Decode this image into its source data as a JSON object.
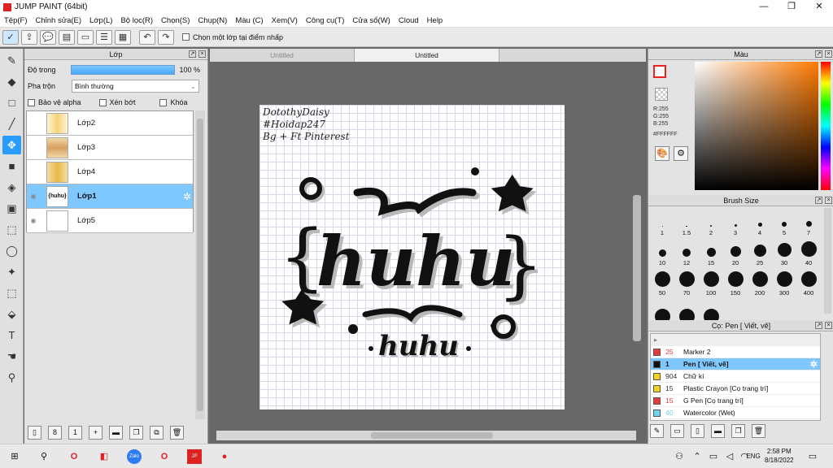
{
  "app": {
    "title": "JUMP PAINT (64bit)"
  },
  "menu": [
    "Tệp(F)",
    "Chỉnh sửa(E)",
    "Lớp(L)",
    "Bộ lọc(R)",
    "Chọn(S)",
    "Chụp(N)",
    "Màu (C)",
    "Xem(V)",
    "Công cụ(T)",
    "Cửa sổ(W)",
    "Cloud",
    "Help"
  ],
  "toolbar": {
    "ref_layer_label": "Chọn một lớp tại điểm nhấp"
  },
  "layer_panel": {
    "title": "Lớp",
    "opacity_label": "Độ trong",
    "opacity_value": "100 %",
    "blend_label": "Pha trộn",
    "blend_value": "Bình thường",
    "protect_alpha": "Bảo vệ alpha",
    "clipping": "Xén bớt",
    "lock": "Khóa",
    "layers": [
      {
        "name": "Lớp2",
        "active": false
      },
      {
        "name": "Lớp3",
        "active": false
      },
      {
        "name": "Lớp4",
        "active": false
      },
      {
        "name": "Lớp1",
        "active": true
      },
      {
        "name": "Lớp5",
        "active": false
      }
    ]
  },
  "canvas": {
    "tabs": [
      "Untitled",
      "Untitled"
    ],
    "text_lines": [
      "DotothyDaisy",
      "#Hoidap247",
      "Bg + Ft Pinterest"
    ],
    "main_word": "huhu",
    "sub_word": "huhu"
  },
  "color_panel": {
    "title": "Màu",
    "r": "R:255",
    "g": "G:255",
    "b": "B:255",
    "hex": "#FFFFFF"
  },
  "brush_size": {
    "title": "Brush Size",
    "sizes": [
      "1",
      "1.5",
      "2",
      "3",
      "4",
      "5",
      "7",
      "10",
      "12",
      "15",
      "20",
      "25",
      "30",
      "40",
      "50",
      "70",
      "100",
      "150",
      "200",
      "300",
      "400",
      "",
      "",
      ""
    ]
  },
  "tool_panel": {
    "title": "Cọ: Pen [ Viết, vẽ]",
    "tools": [
      {
        "size": "25",
        "name": "Marker 2",
        "color": "#e83a3a",
        "active": false
      },
      {
        "size": "1",
        "name": "Pen [ Viết, vẽ]",
        "color": "#111111",
        "active": true
      },
      {
        "size": "904",
        "name": "Chữ kí",
        "color": "#f2d21b",
        "active": false
      },
      {
        "size": "15",
        "name": "Plastic Crayon [Cọ trang trí]",
        "color": "#f2d21b",
        "active": false
      },
      {
        "size": "15",
        "name": "G Pen [Cọ trang trí]",
        "color": "#e83a3a",
        "active": false
      },
      {
        "size": "40",
        "name": "Watercolor (Wet)",
        "color": "#6fd3f2",
        "active": false
      }
    ]
  },
  "taskbar": {
    "time": "2:58 PM",
    "date": "8/18/2022",
    "lang": "ENG"
  },
  "colors": {
    "accent": "#2a9cff",
    "selection": "#7fc8ff"
  }
}
